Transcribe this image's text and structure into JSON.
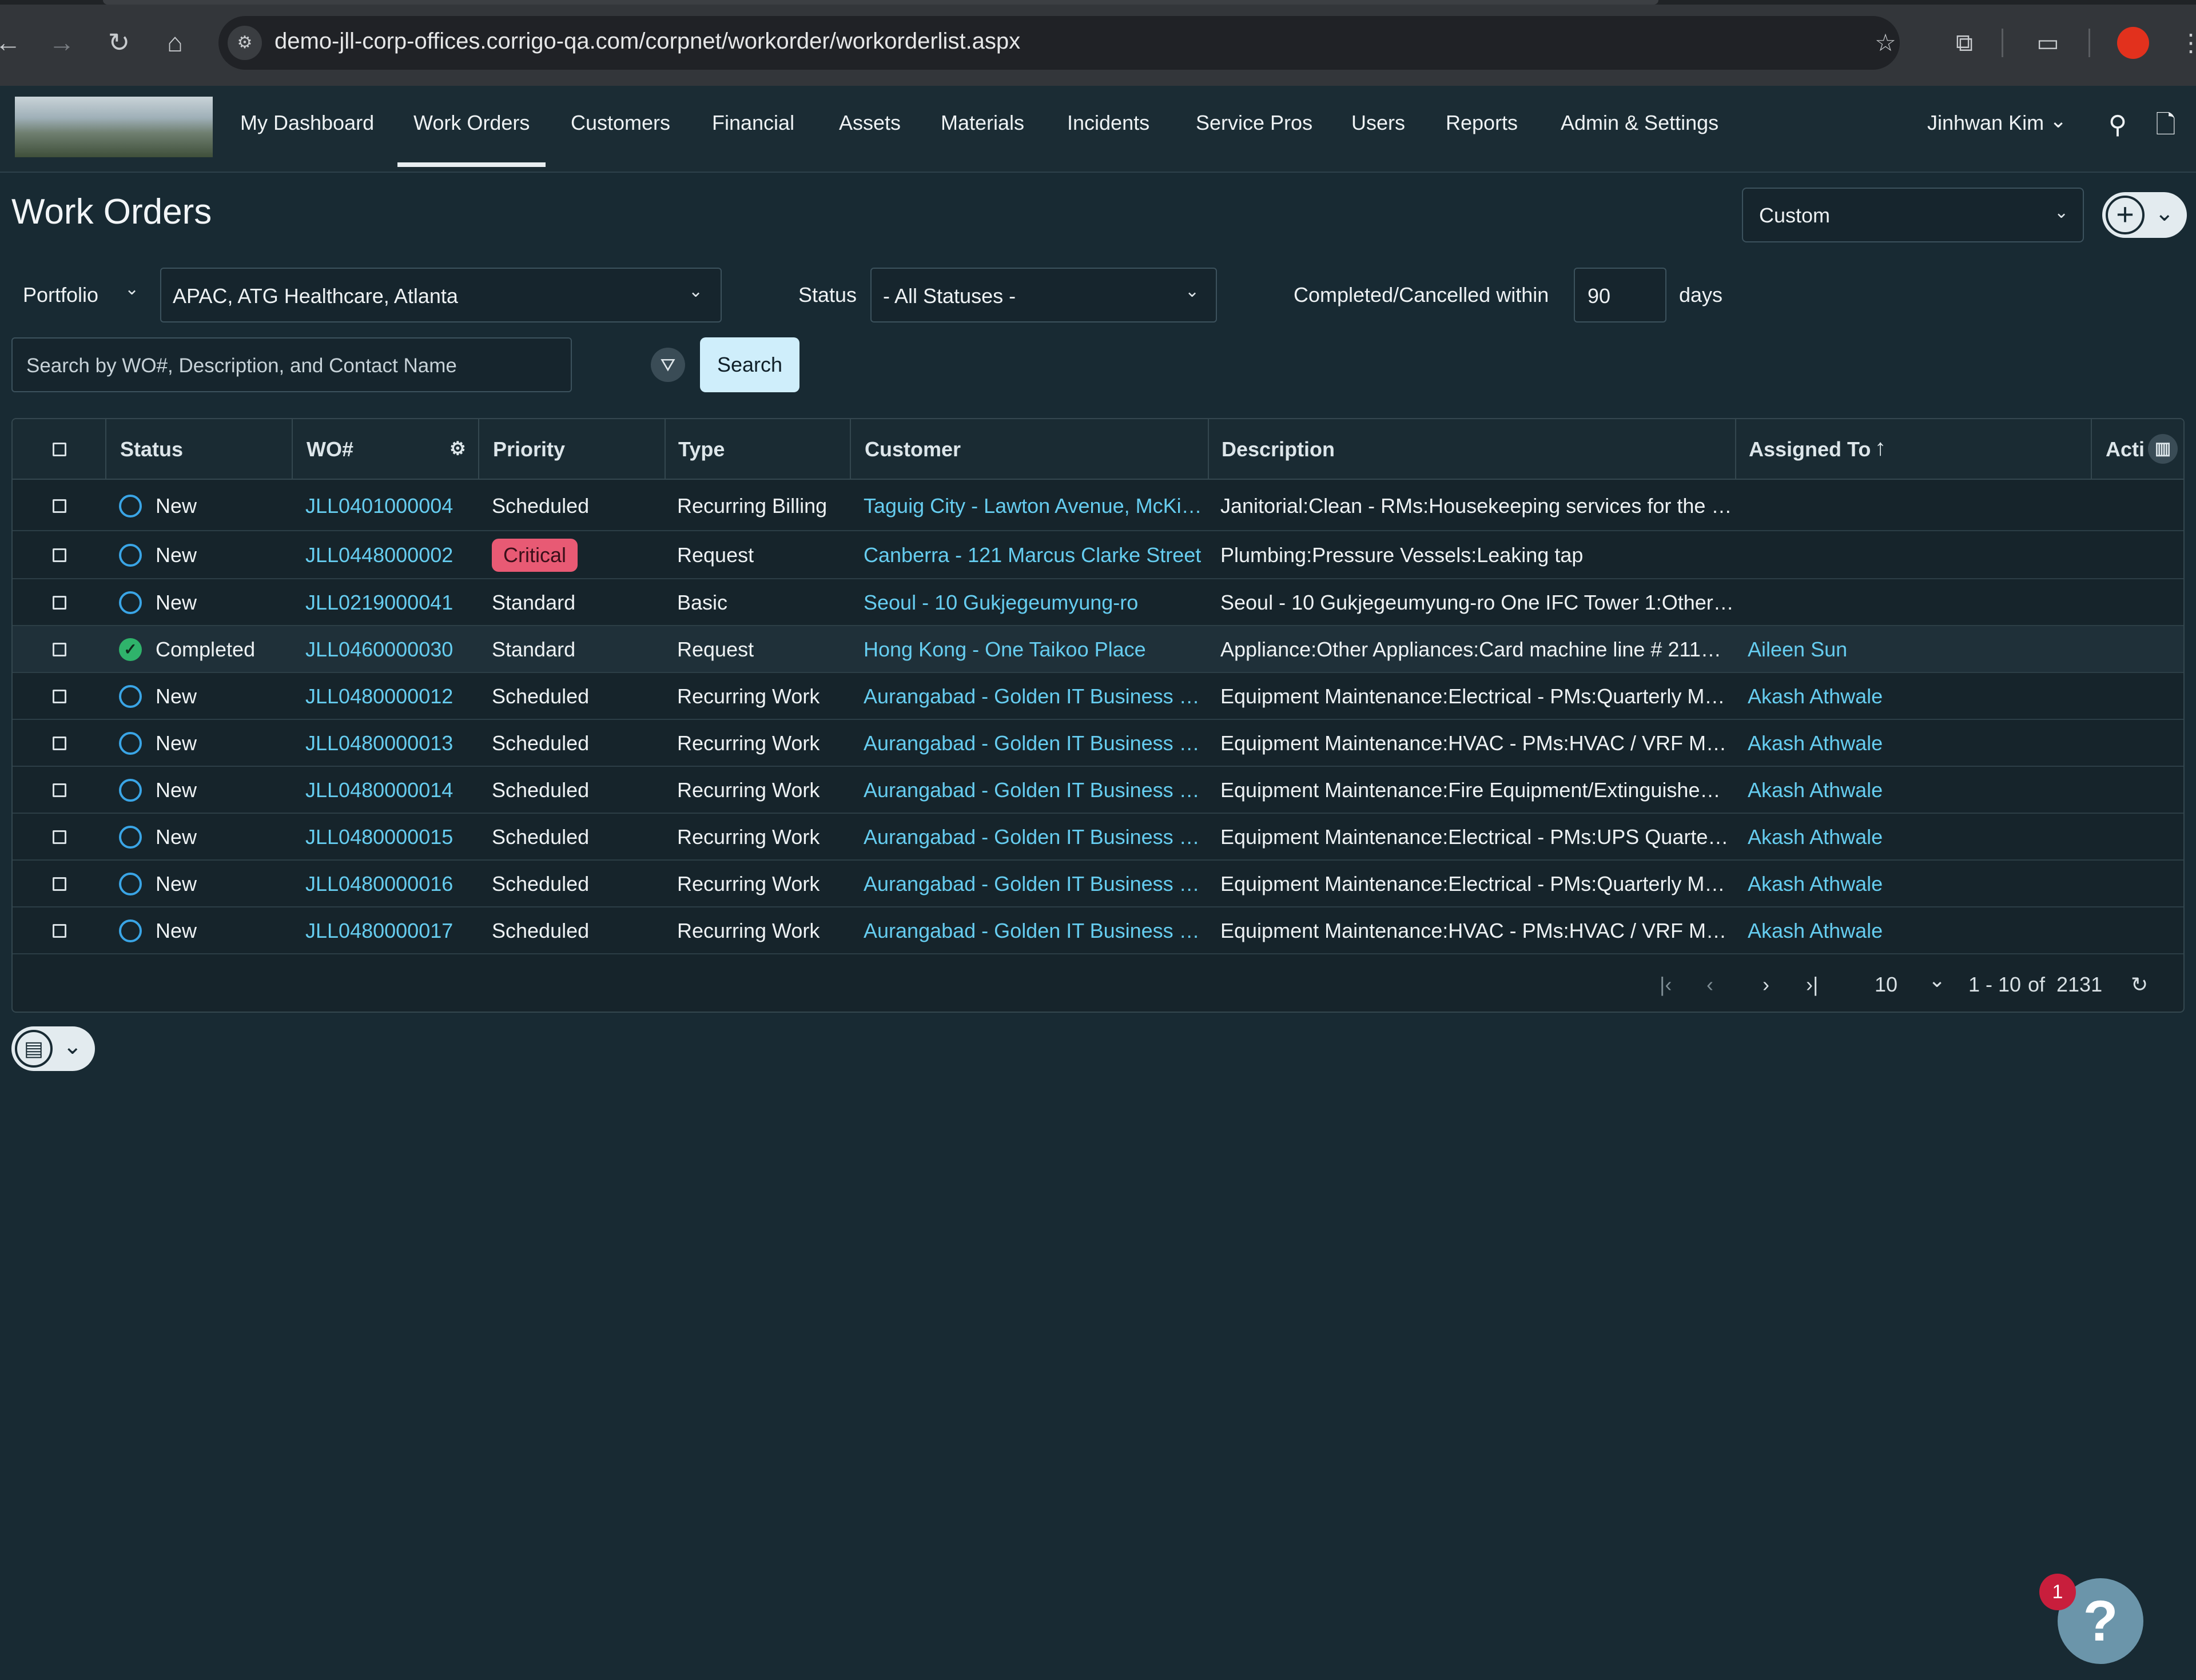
{
  "browser": {
    "url": "demo-jll-corp-offices.corrigo-qa.com/corpnet/workorder/workorderlist.aspx"
  },
  "nav": {
    "items": [
      {
        "label": "My Dashboard"
      },
      {
        "label": "Work Orders"
      },
      {
        "label": "Customers"
      },
      {
        "label": "Financial"
      },
      {
        "label": "Assets"
      },
      {
        "label": "Materials"
      },
      {
        "label": "Incidents"
      },
      {
        "label": "Service Pros"
      },
      {
        "label": "Users"
      },
      {
        "label": "Reports"
      },
      {
        "label": "Admin & Settings"
      }
    ],
    "active": "Work Orders",
    "user": "Jinhwan Kim"
  },
  "page": {
    "title": "Work Orders",
    "view": "Custom"
  },
  "filters": {
    "portfolio_label": "Portfolio",
    "portfolio_value": "APAC, ATG Healthcare, Atlanta",
    "status_label": "Status",
    "status_value": "- All Statuses -",
    "within_label": "Completed/Cancelled within",
    "within_value": "90",
    "days_label": "days",
    "search_placeholder": "Search by WO#, Description, and Contact Name",
    "search_button": "Search"
  },
  "grid": {
    "headers": {
      "status": "Status",
      "wo": "WO#",
      "priority": "Priority",
      "type": "Type",
      "customer": "Customer",
      "description": "Description",
      "assigned": "Assigned To",
      "actions": "Acti"
    },
    "rows": [
      {
        "status": "New",
        "wo": "JLL0401000004",
        "priority": "Scheduled",
        "type": "Recurring Billing",
        "customer": "Taguig City - Lawton Avenue, McKi…",
        "description": "Janitorial:Clean - RMs:Housekeeping services for the …",
        "assigned": ""
      },
      {
        "status": "New",
        "wo": "JLL0448000002",
        "priority": "Critical",
        "type": "Request",
        "customer": "Canberra - 121 Marcus Clarke Street",
        "description": "Plumbing:Pressure Vessels:Leaking tap",
        "assigned": ""
      },
      {
        "status": "New",
        "wo": "JLL0219000041",
        "priority": "Standard",
        "type": "Basic",
        "customer": "Seoul - 10 Gukjegeumyung-ro",
        "description": "Seoul - 10 Gukjegeumyung-ro One IFC Tower 1:Other…",
        "assigned": ""
      },
      {
        "status": "Completed",
        "wo": "JLL0460000030",
        "priority": "Standard",
        "type": "Request",
        "customer": "Hong Kong - One Taikoo Place",
        "description": "Appliance:Other Appliances:Card machine line # 211…",
        "assigned": "Aileen Sun"
      },
      {
        "status": "New",
        "wo": "JLL0480000012",
        "priority": "Scheduled",
        "type": "Recurring Work",
        "customer": "Aurangabad - Golden IT Business …",
        "description": "Equipment Maintenance:Electrical - PMs:Quarterly M…",
        "assigned": "Akash Athwale"
      },
      {
        "status": "New",
        "wo": "JLL0480000013",
        "priority": "Scheduled",
        "type": "Recurring Work",
        "customer": "Aurangabad - Golden IT Business …",
        "description": "Equipment Maintenance:HVAC - PMs:HVAC / VRF Mai…",
        "assigned": "Akash Athwale"
      },
      {
        "status": "New",
        "wo": "JLL0480000014",
        "priority": "Scheduled",
        "type": "Recurring Work",
        "customer": "Aurangabad - Golden IT Business …",
        "description": "Equipment Maintenance:Fire Equipment/Extinguishe…",
        "assigned": "Akash Athwale"
      },
      {
        "status": "New",
        "wo": "JLL0480000015",
        "priority": "Scheduled",
        "type": "Recurring Work",
        "customer": "Aurangabad - Golden IT Business …",
        "description": "Equipment Maintenance:Electrical - PMs:UPS Quarte…",
        "assigned": "Akash Athwale"
      },
      {
        "status": "New",
        "wo": "JLL0480000016",
        "priority": "Scheduled",
        "type": "Recurring Work",
        "customer": "Aurangabad - Golden IT Business …",
        "description": "Equipment Maintenance:Electrical - PMs:Quarterly M…",
        "assigned": "Akash Athwale"
      },
      {
        "status": "New",
        "wo": "JLL0480000017",
        "priority": "Scheduled",
        "type": "Recurring Work",
        "customer": "Aurangabad - Golden IT Business …",
        "description": "Equipment Maintenance:HVAC - PMs:HVAC / VRF Mai…",
        "assigned": "Akash Athwale"
      }
    ]
  },
  "pager": {
    "page_size": "10",
    "range": "1 - 10",
    "of_label": "of",
    "total": "2131"
  },
  "help": {
    "badge": "1",
    "glyph": "?"
  },
  "colors": {
    "background": "#182a33",
    "link": "#66cdf0",
    "critical_badge": "#e85a74",
    "status_new": "#3aa5e6",
    "status_completed": "#2fb36b"
  }
}
